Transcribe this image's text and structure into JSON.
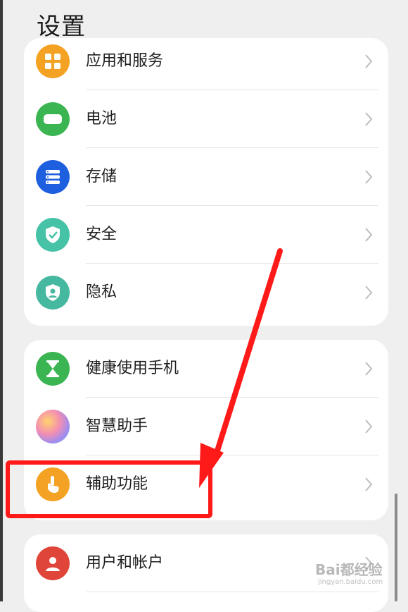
{
  "page": {
    "title": "设置"
  },
  "groups": [
    {
      "items": [
        {
          "label": "应用和服务",
          "icon": "apps-services-icon",
          "color": "#f4a223"
        },
        {
          "label": "电池",
          "icon": "battery-icon",
          "color": "#3bb552"
        },
        {
          "label": "存储",
          "icon": "storage-icon",
          "color": "#1e5fe0"
        },
        {
          "label": "安全",
          "icon": "security-shield-icon",
          "color": "#46c2a6"
        },
        {
          "label": "隐私",
          "icon": "privacy-icon",
          "color": "#46b8a0"
        }
      ]
    },
    {
      "items": [
        {
          "label": "健康使用手机",
          "icon": "hourglass-icon",
          "color": "#3bb552"
        },
        {
          "label": "智慧助手",
          "icon": "smart-assistant-icon",
          "color": "#b58fe8"
        },
        {
          "label": "辅助功能",
          "icon": "accessibility-hand-icon",
          "color": "#f4a223"
        }
      ]
    },
    {
      "items": [
        {
          "label": "用户和帐户",
          "icon": "user-accounts-icon",
          "color": "#e0453a"
        }
      ]
    }
  ],
  "watermark": {
    "text": "Bai都经验",
    "sub": "jingyan.baidu.com"
  },
  "annotation": {
    "color": "#ff1a1a"
  }
}
